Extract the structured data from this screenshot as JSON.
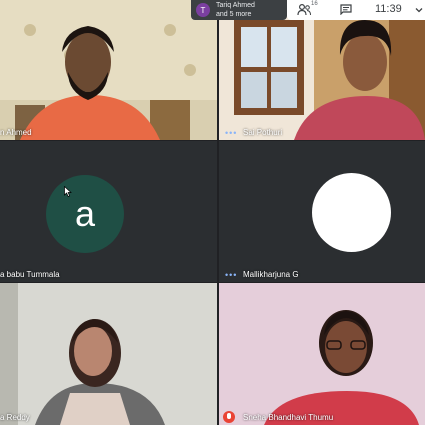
{
  "participants_chip": {
    "avatar_initial": "T",
    "line1": "Tariq Ahmed",
    "line2": "and 5 more"
  },
  "topbar": {
    "people_count": "16",
    "time": "11:39"
  },
  "tiles": [
    {
      "name": "n Ahmed",
      "type": "video"
    },
    {
      "name": "Sai Pothuri",
      "type": "video"
    },
    {
      "name": "a babu Tummala",
      "type": "avatar",
      "avatar_initial": "a",
      "avatar_color": "#1f4f45"
    },
    {
      "name": "Mallikharjuna G",
      "type": "avatar",
      "avatar_color": "#ffffff"
    },
    {
      "name": "a Reddy",
      "type": "video"
    },
    {
      "name": "Sneha Bhandhavi Thumu",
      "type": "video",
      "muted": true
    }
  ],
  "colors": {
    "background": "#202124",
    "tile_bg": "#2b2e31",
    "mute": "#ea4335",
    "chip_bg": "#3c4043"
  }
}
